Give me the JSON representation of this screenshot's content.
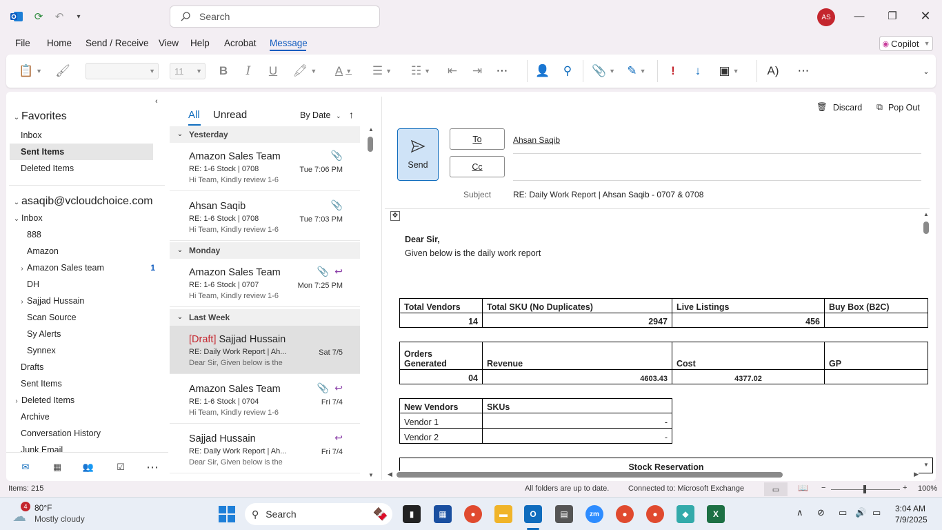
{
  "titlebar": {
    "search_placeholder": "Search",
    "avatar_initials": "AS"
  },
  "menu": {
    "items": [
      "File",
      "Home",
      "Send / Receive",
      "View",
      "Help",
      "Acrobat",
      "Message"
    ],
    "active": "Message",
    "copilot_label": "Copilot"
  },
  "ribbon": {
    "font_size": "11"
  },
  "folders": {
    "favorites_label": "Favorites",
    "favorites": [
      "Inbox",
      "Sent Items",
      "Deleted Items"
    ],
    "account": "asaqib@vcloudchoice.com",
    "inbox_label": "Inbox",
    "inbox_children": [
      "888",
      "Amazon",
      "Amazon Sales team",
      "DH",
      "Sajjad Hussain",
      "Scan Source",
      "Sy Alerts",
      "Synnex"
    ],
    "amazon_sales_team_unread": "1",
    "other": [
      "Drafts",
      "Sent Items",
      "Deleted Items",
      "Archive",
      "Conversation History",
      "Junk Email"
    ]
  },
  "message_list": {
    "tab_all": "All",
    "tab_unread": "Unread",
    "sort_label": "By Date",
    "groups": {
      "yesterday": "Yesterday",
      "monday": "Monday",
      "last_week": "Last Week"
    },
    "messages": [
      {
        "from": "Amazon Sales Team",
        "subject": "RE: 1-6 Stock | 0708",
        "preview": "Hi Team,  Kindly review 1-6",
        "date": "Tue 7:06 PM"
      },
      {
        "from": "Ahsan Saqib",
        "subject": "RE: 1-6 Stock | 0708",
        "preview": "Hi Team,  Kindly review 1-6",
        "date": "Tue 7:03 PM"
      },
      {
        "from": "Amazon Sales Team",
        "subject": "RE: 1-6 Stock | 0707",
        "preview": "Hi Team,  Kindly review 1-6",
        "date": "Mon 7:25 PM"
      },
      {
        "draft": "[Draft]",
        "from": "Sajjad Hussain",
        "subject": "RE: Daily Work Report | Ah...",
        "preview": "Dear Sir,  Given below is the",
        "date": "Sat 7/5"
      },
      {
        "from": "Amazon Sales Team",
        "subject": "RE: 1-6 Stock | 0704",
        "preview": "Hi Team,  Kindly review 1-6",
        "date": "Fri 7/4"
      },
      {
        "from": "Sajjad Hussain",
        "subject": "RE: Daily Work Report | Ah...",
        "preview": "Dear Sir,  Given below is the",
        "date": "Fri 7/4"
      }
    ]
  },
  "compose": {
    "discard_label": "Discard",
    "popout_label": "Pop Out",
    "send_label": "Send",
    "to_label": "To",
    "cc_label": "Cc",
    "to_value": "Ahsan Saqib",
    "subject_label": "Subject",
    "subject_value": "RE: Daily Work Report | Ahsan Saqib - 0707 & 0708",
    "greeting": "Dear Sir,",
    "intro": "Given below is the daily work report",
    "table1": {
      "headers": [
        "Total Vendors",
        "Total SKU (No Duplicates)",
        "Live Listings",
        "Buy Box (B2C)"
      ],
      "values": [
        "14",
        "2947",
        "456",
        ""
      ]
    },
    "table2": {
      "headers": [
        "Orders Generated",
        "Revenue",
        "Cost",
        "GP"
      ],
      "values": [
        "04",
        "4603.43",
        "4377.02",
        ""
      ]
    },
    "table3": {
      "headers": [
        "New Vendors",
        "SKUs"
      ],
      "rows": [
        [
          "Vendor 1",
          "-"
        ],
        [
          "Vendor 2",
          "-"
        ]
      ]
    },
    "table4_title": "Stock Reservation"
  },
  "status": {
    "items": "Items: 215",
    "sync": "All folders are up to date.",
    "connection": "Connected to: Microsoft Exchange",
    "zoom": "100%"
  },
  "taskbar": {
    "weather_temp": "80°F",
    "weather_desc": "Mostly cloudy",
    "weather_badge": "4",
    "search_label": "Search",
    "time": "3:04 AM",
    "date": "7/9/2025"
  },
  "colors": {
    "accent": "#0f6cbd",
    "draft_red": "#c4262e",
    "reply_purple": "#8a3ea8"
  }
}
